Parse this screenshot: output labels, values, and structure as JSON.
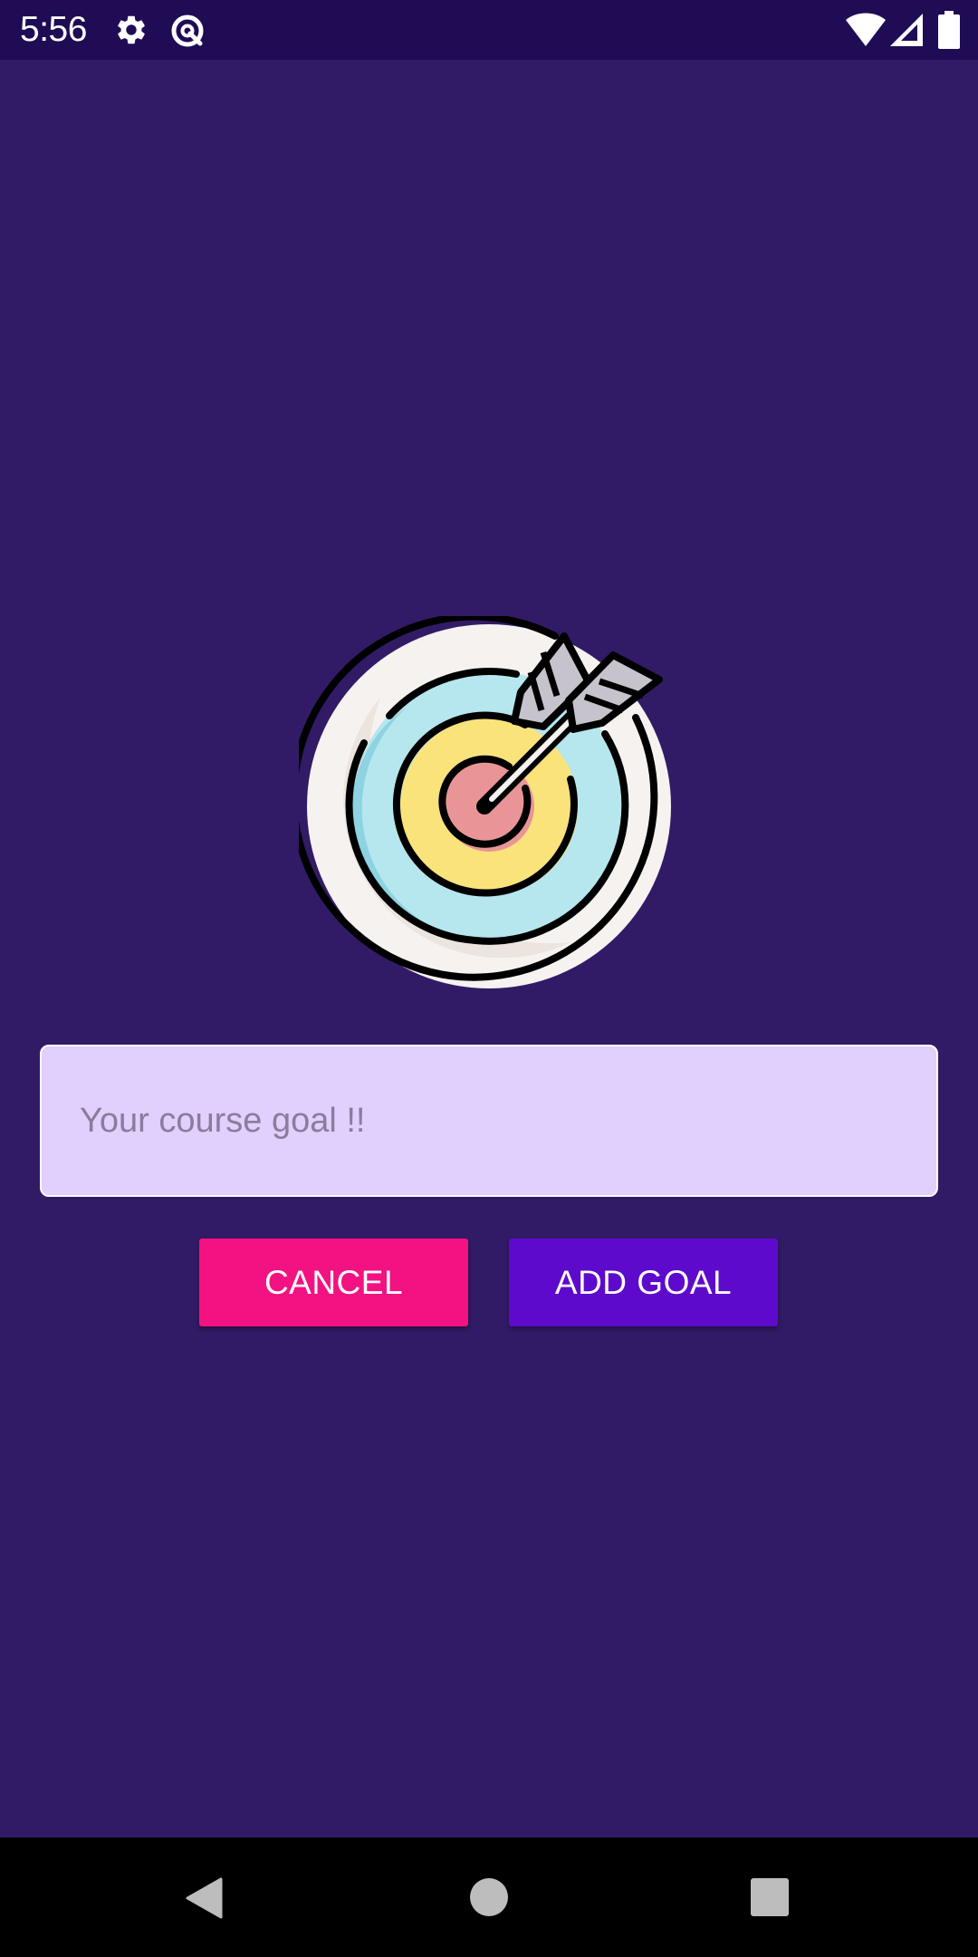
{
  "status_bar": {
    "time": "5:56",
    "icons": [
      "settings-icon",
      "data-saver-icon",
      "wifi-icon",
      "signal-icon",
      "battery-icon"
    ]
  },
  "colors": {
    "status_bar_bg": "#1f0c54",
    "app_bg": "#311b66",
    "input_bg": "#e1cffe",
    "cancel_button": "#f31282",
    "add_button": "#5e0acc",
    "nav_bar_bg": "#000000"
  },
  "goal_image": {
    "icon": "target-with-arrow-icon"
  },
  "goal_input": {
    "value": "",
    "placeholder": "Your course goal !!"
  },
  "buttons": {
    "cancel_label": "CANCEL",
    "add_label": "ADD GOAL"
  },
  "nav_bar": {
    "icons": [
      "back-icon",
      "home-icon",
      "recents-icon"
    ]
  }
}
